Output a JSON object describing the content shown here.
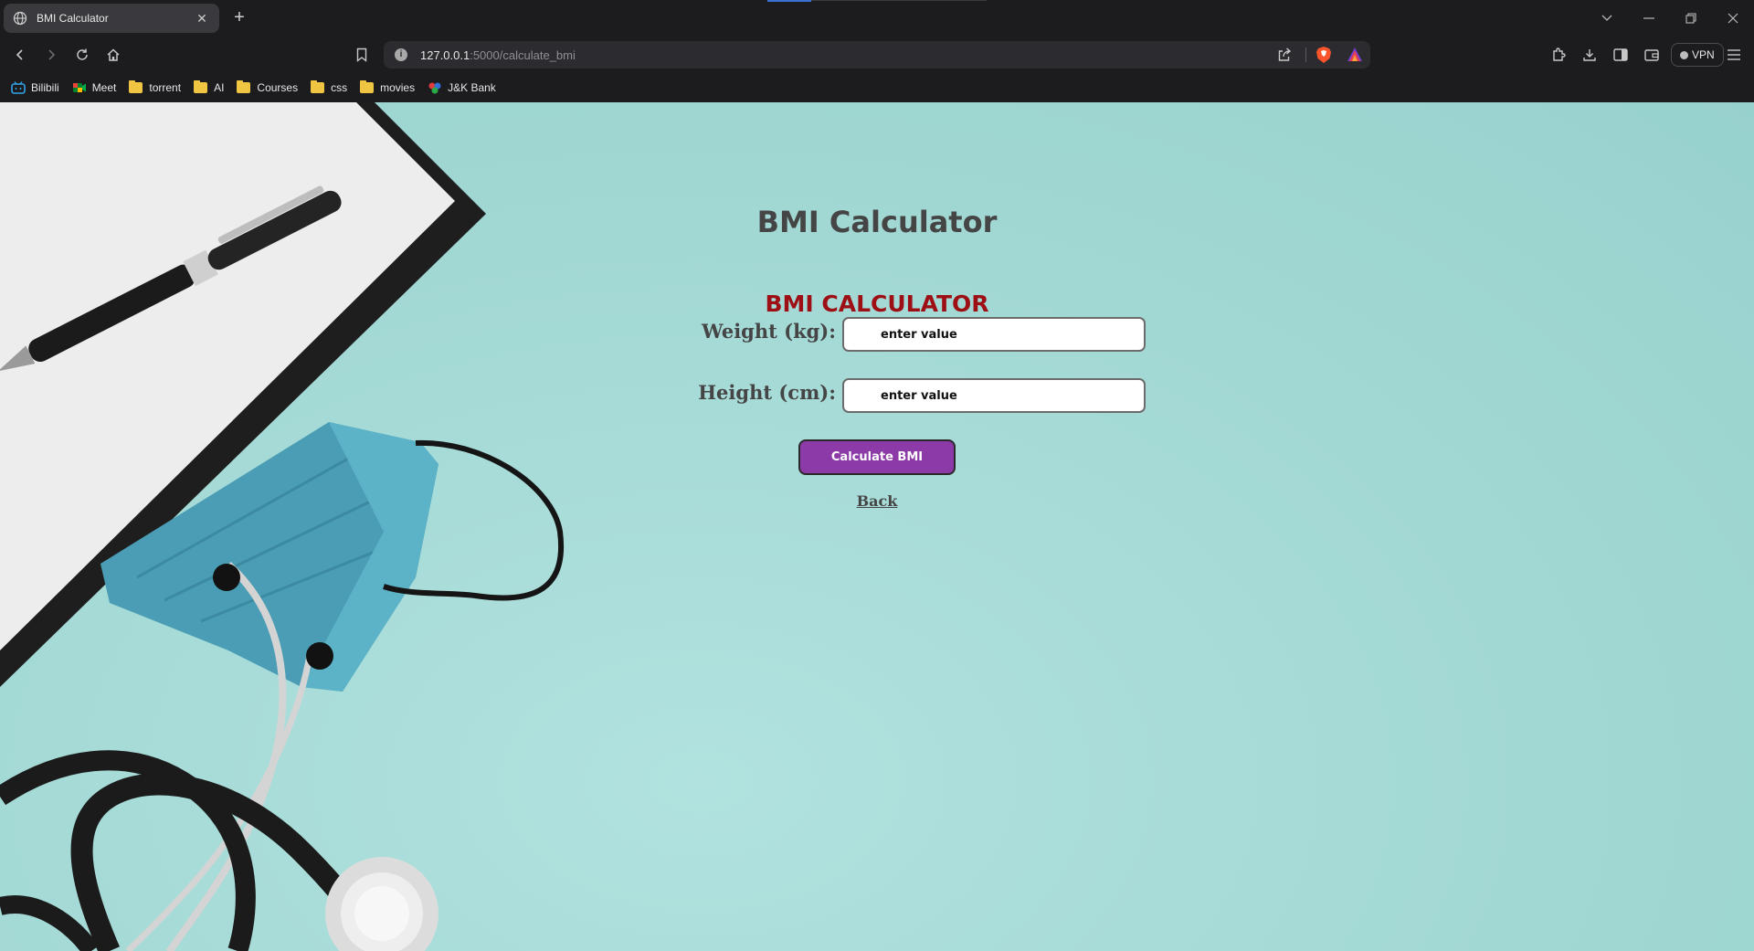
{
  "browser": {
    "tab_title": "BMI Calculator",
    "new_tab_symbol": "+",
    "url_host": "127.0.0.1",
    "url_rest": ":5000/calculate_bmi",
    "vpn_label": "VPN",
    "bookmarks": [
      {
        "label": "Bilibili",
        "icon": "bilibili-icon"
      },
      {
        "label": "Meet",
        "icon": "meet-icon"
      },
      {
        "label": "torrent",
        "icon": "folder-icon"
      },
      {
        "label": "AI",
        "icon": "folder-icon"
      },
      {
        "label": "Courses",
        "icon": "folder-icon"
      },
      {
        "label": "css",
        "icon": "folder-icon"
      },
      {
        "label": "movies",
        "icon": "folder-icon"
      },
      {
        "label": "J&K Bank",
        "icon": "jk-bank-icon"
      }
    ]
  },
  "page": {
    "heading": "BMI Calculator",
    "form_title": "BMI CALCULATOR",
    "weight_label": "Weight (kg):",
    "weight_placeholder": "enter value",
    "height_label": "Height (cm):",
    "height_placeholder": "enter value",
    "calculate_label": "Calculate BMI",
    "back_label": "Back"
  },
  "colors": {
    "background": "#a5dad6",
    "heading": "#454545",
    "form_title": "#9d0f14",
    "button": "#8c3aa7",
    "browser_chrome": "#1c1c1f"
  }
}
